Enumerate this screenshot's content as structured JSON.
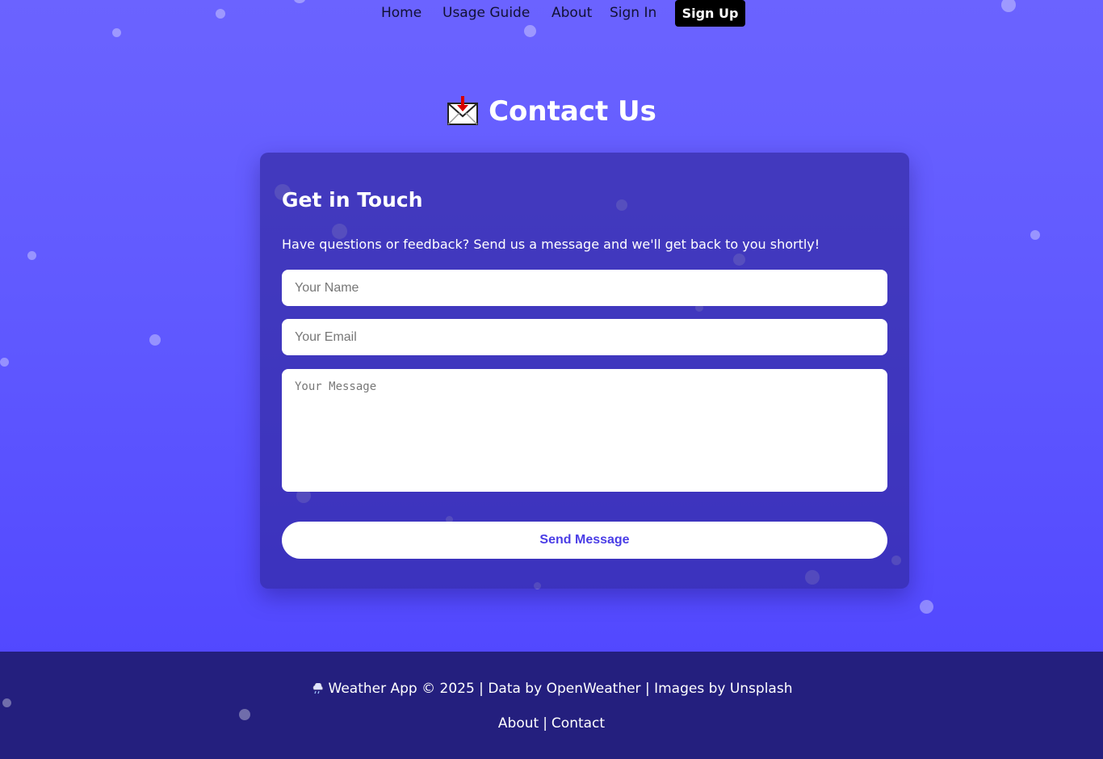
{
  "nav": {
    "home": "Home",
    "usage_guide": "Usage Guide",
    "about": "About",
    "sign_in": "Sign In",
    "sign_up": "Sign Up"
  },
  "page": {
    "title": "Contact Us",
    "icon": "incoming-envelope-icon"
  },
  "card": {
    "heading": "Get in Touch",
    "description": "Have questions or feedback? Send us a message and we'll get back to you shortly!",
    "name_placeholder": "Your Name",
    "email_placeholder": "Your Email",
    "message_placeholder": "Your Message",
    "send_label": "Send Message"
  },
  "footer": {
    "icon": "cloud-rain-icon",
    "credits": "Weather App © 2025 | Data by OpenWeather | Images by Unsplash",
    "about_link": "About",
    "separator": "|",
    "contact_link": "Contact"
  },
  "colors": {
    "background_top": "#6b63ff",
    "background_bottom": "#4e43ff",
    "card": "#3a2fb0",
    "footer": "#241f7e",
    "button_text": "#4a3de6"
  }
}
